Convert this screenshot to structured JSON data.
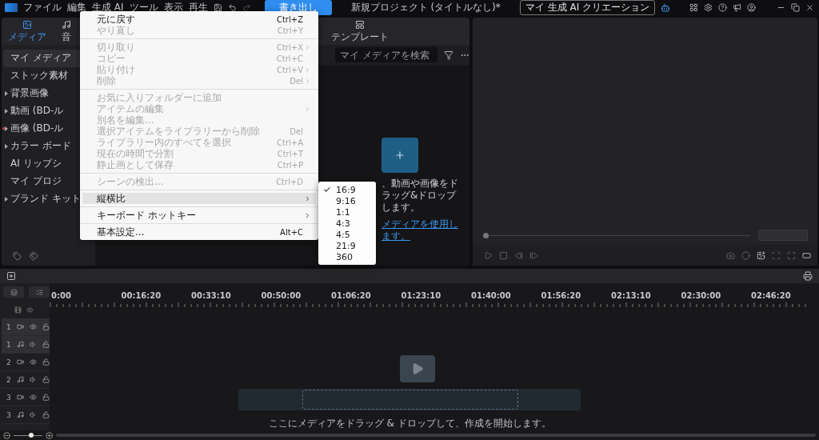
{
  "menubar": {
    "items": [
      "ファイル",
      "編集",
      "生成 AI",
      "ツール",
      "表示",
      "再生"
    ],
    "export_button": "書き出し"
  },
  "window": {
    "title": "新規プロジェクト (タイトルなし)*",
    "ai_button": "マイ 生成 AI クリエーション"
  },
  "media_tabs": [
    {
      "label": "メディア",
      "selected": true,
      "kind": "media"
    },
    {
      "label": "音",
      "selected": false,
      "kind": "music"
    },
    {
      "label": "テンプレート",
      "selected": false,
      "kind": "template"
    }
  ],
  "sidebar": {
    "items": [
      {
        "label": "マイ メディア",
        "selected": true,
        "expandable": false,
        "marked": false
      },
      {
        "label": "ストック素材",
        "selected": false,
        "expandable": false,
        "marked": false
      },
      {
        "label": "背景画像",
        "selected": false,
        "expandable": true,
        "marked": false
      },
      {
        "label": "動画 (BD-ル",
        "selected": false,
        "expandable": true,
        "marked": false
      },
      {
        "label": "画像 (BD-ル",
        "selected": false,
        "expandable": true,
        "marked": true
      },
      {
        "label": "カラー ボード",
        "selected": false,
        "expandable": true,
        "marked": false
      },
      {
        "label": "AI リップシ",
        "selected": false,
        "expandable": false,
        "marked": false
      },
      {
        "label": "マイ プロジ",
        "selected": false,
        "expandable": false,
        "marked": false
      },
      {
        "label": "ブランド キット",
        "selected": false,
        "expandable": true,
        "marked": false
      }
    ]
  },
  "search": {
    "placeholder": "マイ メディアを検索"
  },
  "drop_hint": {
    "text": "、動画や画像をドラッグ&ドロップします。",
    "link": "メディアを使用します。"
  },
  "edit_menu": {
    "items": [
      {
        "kind": "item",
        "label": "元に戻す",
        "shortcut": "Ctrl+Z",
        "disabled": false,
        "submenu": false,
        "selected": false
      },
      {
        "kind": "item",
        "label": "やり直し",
        "shortcut": "Ctrl+Y",
        "disabled": true,
        "submenu": false,
        "selected": false
      },
      {
        "kind": "separator"
      },
      {
        "kind": "item",
        "label": "切り取り",
        "shortcut": "Ctrl+X",
        "disabled": true,
        "submenu": true,
        "selected": false
      },
      {
        "kind": "item",
        "label": "コピー",
        "shortcut": "Ctrl+C",
        "disabled": true,
        "submenu": false,
        "selected": false
      },
      {
        "kind": "item",
        "label": "貼り付け",
        "shortcut": "Ctrl+V",
        "disabled": true,
        "submenu": true,
        "selected": false
      },
      {
        "kind": "item",
        "label": "削除",
        "shortcut": "Del",
        "disabled": true,
        "submenu": true,
        "selected": false
      },
      {
        "kind": "separator"
      },
      {
        "kind": "item",
        "label": "お気に入りフォルダーに追加",
        "disabled": true,
        "submenu": false,
        "selected": false
      },
      {
        "kind": "item",
        "label": "アイテムの編集",
        "disabled": true,
        "submenu": true,
        "selected": false
      },
      {
        "kind": "item",
        "label": "別名を編集...",
        "disabled": true,
        "submenu": false,
        "selected": false
      },
      {
        "kind": "item",
        "label": "選択アイテムをライブラリーから削除",
        "shortcut": "Del",
        "disabled": true,
        "submenu": false,
        "selected": false
      },
      {
        "kind": "item",
        "label": "ライブラリー内のすべてを選択",
        "shortcut": "Ctrl+A",
        "disabled": true,
        "submenu": false,
        "selected": false
      },
      {
        "kind": "item",
        "label": "現在の時間で分割",
        "shortcut": "Ctrl+T",
        "disabled": true,
        "submenu": false,
        "selected": false
      },
      {
        "kind": "item",
        "label": "静止画として保存",
        "shortcut": "Ctrl+P",
        "disabled": true,
        "submenu": false,
        "selected": false
      },
      {
        "kind": "separator"
      },
      {
        "kind": "item",
        "label": "シーンの検出...",
        "shortcut": "Ctrl+D",
        "disabled": true,
        "submenu": false,
        "selected": false
      },
      {
        "kind": "separator"
      },
      {
        "kind": "item",
        "label": "縦横比",
        "disabled": false,
        "submenu": true,
        "selected": true
      },
      {
        "kind": "separator"
      },
      {
        "kind": "item",
        "label": "キーボード ホットキー",
        "disabled": false,
        "submenu": true,
        "selected": false
      },
      {
        "kind": "separator"
      },
      {
        "kind": "item",
        "label": "基本設定...",
        "shortcut": "Alt+C",
        "disabled": false,
        "submenu": false,
        "selected": false
      }
    ]
  },
  "aspect_menu": {
    "items": [
      {
        "label": "16:9",
        "selected": true
      },
      {
        "label": "9:16",
        "selected": false
      },
      {
        "label": "1:1",
        "selected": false
      },
      {
        "label": "4:3",
        "selected": false
      },
      {
        "label": "4:5",
        "selected": false
      },
      {
        "label": "21:9",
        "selected": false
      },
      {
        "label": "360",
        "selected": false
      }
    ]
  },
  "preview": {
    "seek": {
      "level": 0
    }
  },
  "timeline": {
    "ruler": [
      "0:00",
      "00:16:20",
      "00:33:10",
      "00:50:00",
      "01:06:20",
      "01:23:10",
      "01:40:00",
      "01:56:20",
      "02:13:10",
      "02:30:00",
      "02:46:20"
    ],
    "tracks": [
      {
        "number": "1",
        "kind": "video",
        "selected": true
      },
      {
        "number": "1",
        "kind": "audio",
        "selected": true
      },
      {
        "number": "2",
        "kind": "video",
        "selected": false
      },
      {
        "number": "2",
        "kind": "audio",
        "selected": false
      },
      {
        "number": "3",
        "kind": "video",
        "selected": false
      },
      {
        "number": "3",
        "kind": "audio",
        "selected": false
      }
    ],
    "drop_hint": "ここにメディアをドラッグ & ドロップして、作成を開始します。",
    "zoom": {
      "level": 0.6
    }
  }
}
